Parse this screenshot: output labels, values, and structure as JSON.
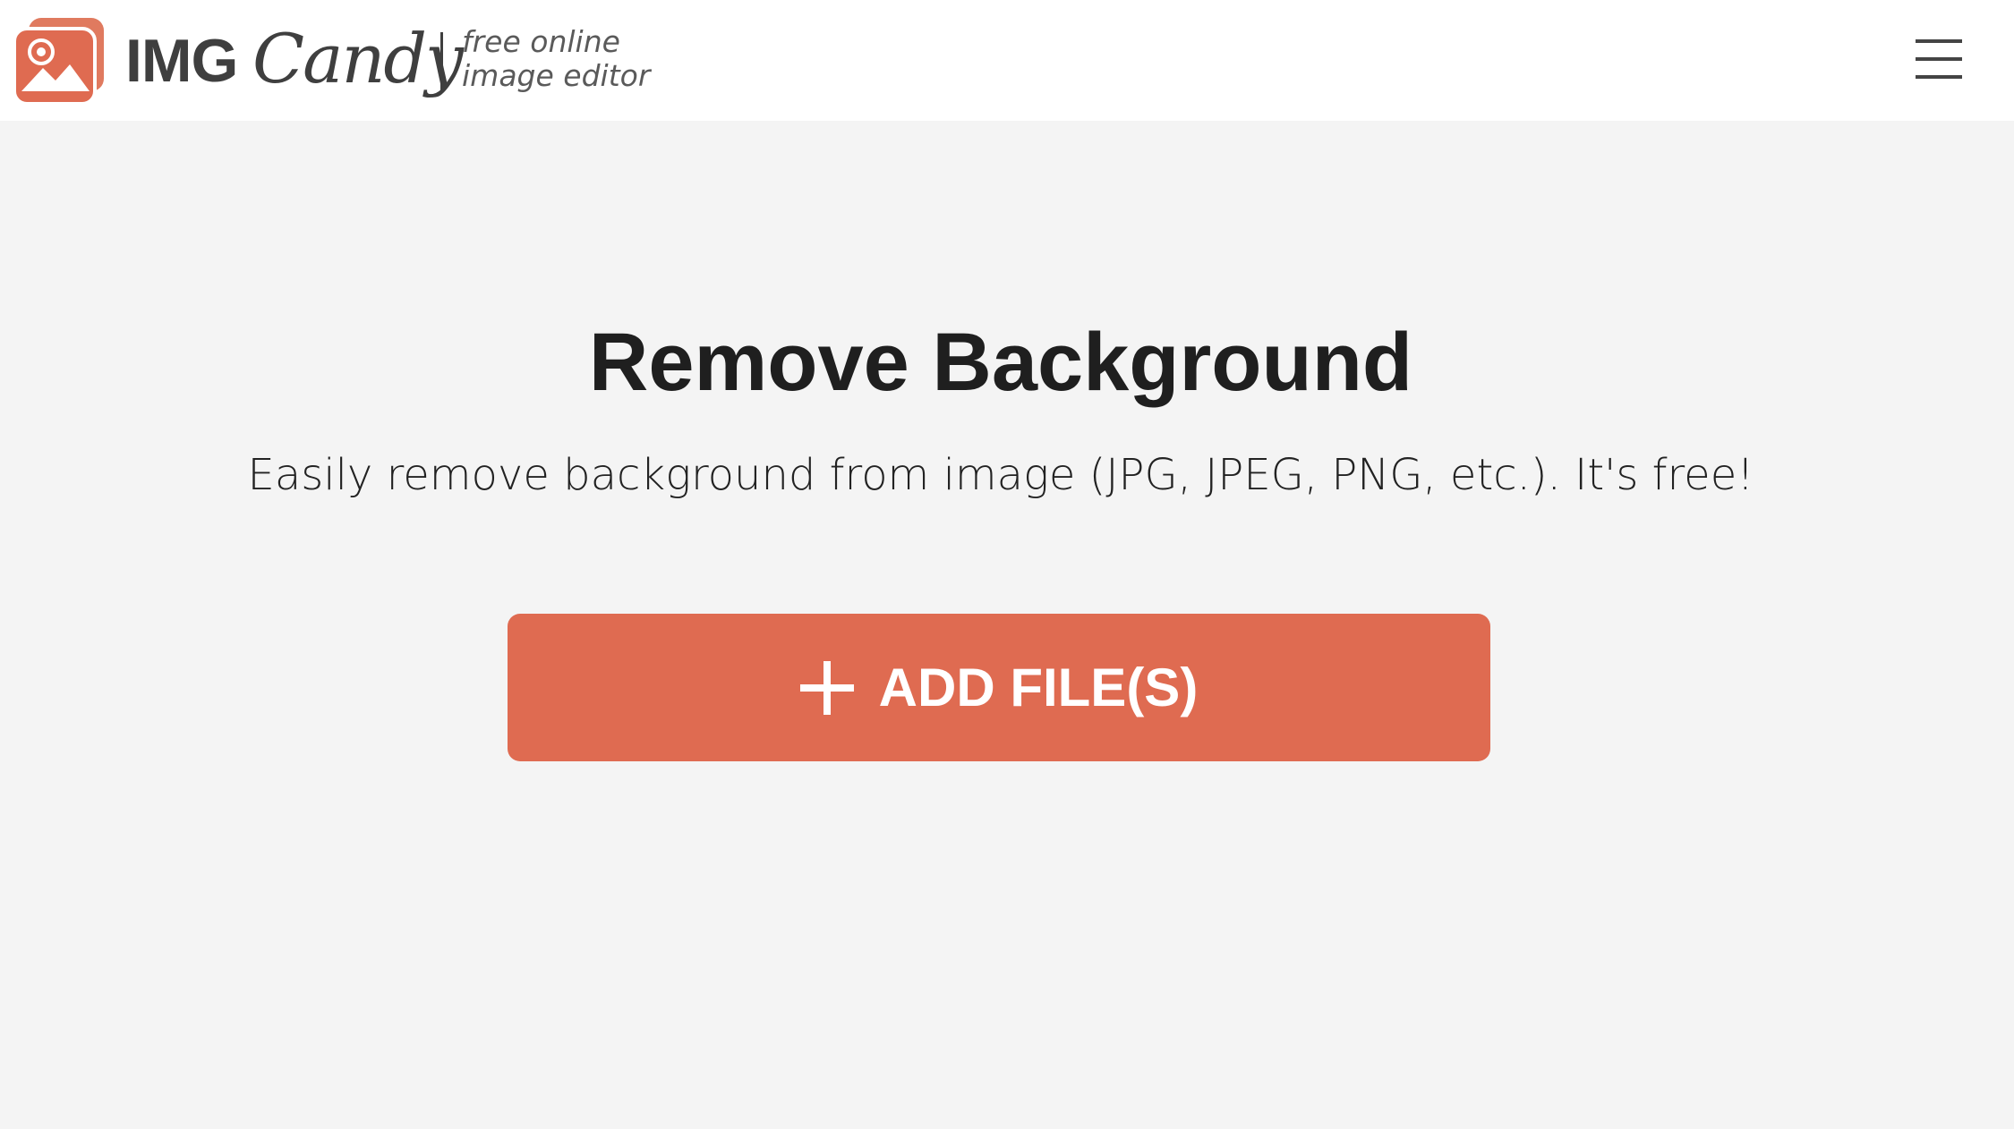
{
  "header": {
    "brand_primary": "IMG",
    "brand_secondary": "Candy",
    "tagline_line1": "free online",
    "tagline_line2": "image editor",
    "logo_icon": "image-swirl-logo-icon",
    "menu_icon": "hamburger-menu-icon"
  },
  "main": {
    "title": "Remove Background",
    "subtitle": "Easily remove background from image (JPG, JPEG, PNG, etc.). It's free!",
    "add_button_label": "ADD FILE(S)",
    "add_button_icon": "plus-icon"
  },
  "colors": {
    "accent": "#df6b51",
    "background": "#f4f4f4",
    "header_background": "#ffffff",
    "text_dark": "#1f1f1f",
    "brand_text": "#3f3f3f"
  }
}
